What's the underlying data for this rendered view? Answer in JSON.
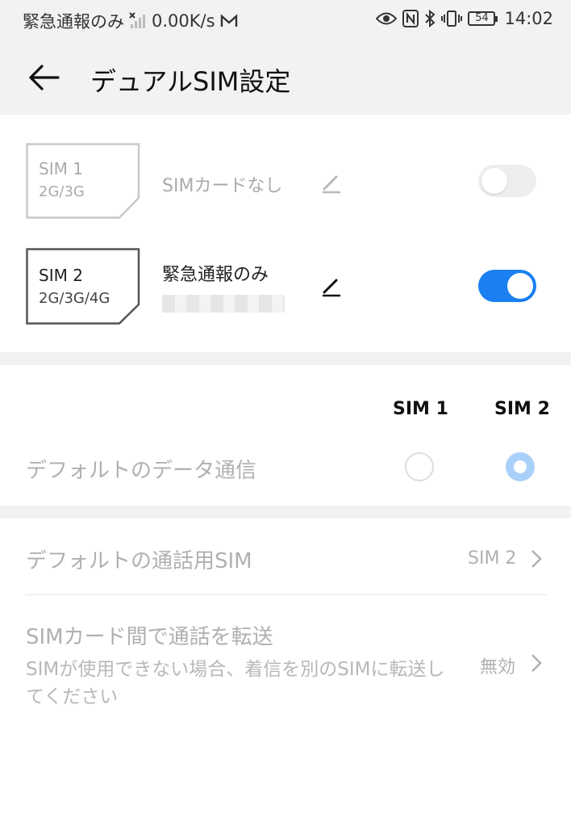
{
  "status_bar": {
    "carrier": "緊急通報のみ",
    "speed": "0.00K/s",
    "battery": "54",
    "time": "14:02"
  },
  "app_bar": {
    "title": "デュアルSIM設定"
  },
  "sims": [
    {
      "card_line1": "SIM 1",
      "card_line2": "2G/3G",
      "name": "SIMカードなし",
      "enabled": false
    },
    {
      "card_line1": "SIM 2",
      "card_line2": "2G/3G/4G",
      "name": "緊急通報のみ",
      "enabled": true
    }
  ],
  "default_data": {
    "col_sim1": "SIM 1",
    "col_sim2": "SIM 2",
    "label": "デフォルトのデータ通信",
    "selected": "SIM 2"
  },
  "default_call": {
    "label": "デフォルトの通話用SIM",
    "value": "SIM 2"
  },
  "call_forward": {
    "label": "SIMカード間で通話を転送",
    "description": "SIMが使用できない場合、着信を別のSIMに転送してください",
    "value": "無効"
  },
  "colors": {
    "accent": "#1a7ff0",
    "accent_light": "#a9d0f8",
    "disabled_text": "#b0b0b0"
  }
}
